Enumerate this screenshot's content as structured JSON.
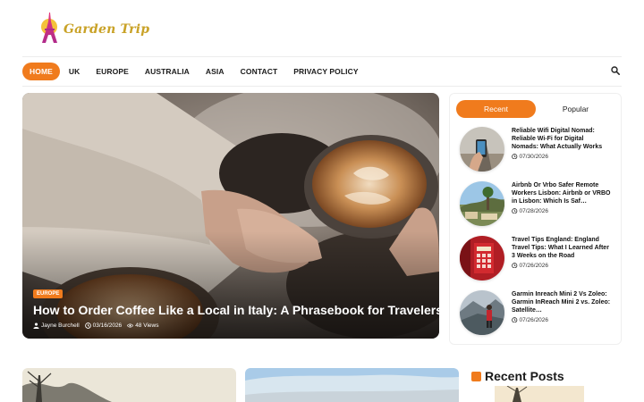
{
  "site": {
    "logo_text": "Garden Trip",
    "logo_icon": "eiffel-tower-icon"
  },
  "nav": {
    "items": [
      {
        "label": "HOME",
        "active": true
      },
      {
        "label": "UK"
      },
      {
        "label": "EUROPE"
      },
      {
        "label": "AUSTRALIA"
      },
      {
        "label": "ASIA"
      },
      {
        "label": "CONTACT"
      },
      {
        "label": "PRIVACY POLICY"
      }
    ],
    "search_icon": "search-icon"
  },
  "hero": {
    "category": "EUROPE",
    "title": "How to Order Coffee Like a Local in Italy: A Phrasebook for Travelers",
    "author": "Jayne Burchell",
    "date": "03/16/2026",
    "views": "48 Views"
  },
  "sidebar": {
    "tabs": [
      {
        "label": "Recent",
        "active": true
      },
      {
        "label": "Popular"
      }
    ],
    "posts": [
      {
        "title": "Reliable Wifi Digital Nomad: Reliable Wi-Fi for Digital Nomads: What Actually Works",
        "date": "07/30/2026"
      },
      {
        "title": "Airbnb Or Vrbo Safer Remote Workers Lisbon: Airbnb or VRBO in Lisbon: Which Is Saf…",
        "date": "07/28/2026"
      },
      {
        "title": "Travel Tips England: England Travel Tips: What I Learned After 3 Weeks on the Road",
        "date": "07/26/2026"
      },
      {
        "title": "Garmin Inreach Mini 2 Vs Zoleo: Garmin InReach Mini 2 vs. Zoleo: Satellite…",
        "date": "07/26/2026"
      }
    ]
  },
  "recent_posts": {
    "heading": "Recent Posts"
  },
  "colors": {
    "accent": "#f07b1d",
    "logo": "#c9a227"
  }
}
